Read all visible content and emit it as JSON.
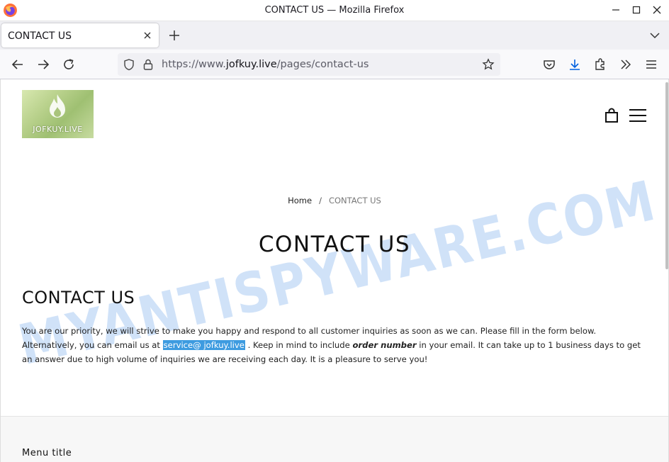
{
  "window": {
    "title": "CONTACT US — Mozilla Firefox"
  },
  "tabs": [
    {
      "label": "CONTACT US"
    }
  ],
  "urlbar": {
    "prefix": "https://www.",
    "domain": "jofkuy.live",
    "path": "/pages/contact-us"
  },
  "site": {
    "logo_text": "JOFKUY.LIVE",
    "watermark": "MYANTISPYWARE.COM"
  },
  "breadcrumb": {
    "home": "Home",
    "separator": "/",
    "current": "CONTACT US"
  },
  "page": {
    "heading": "CONTACT US",
    "section_heading": "CONTACT US",
    "paragraph_part1": "You are our priority, we will strive to make you happy and respond to all customer inquiries as soon as we can. Please fill in the form below. Alternatively, you can email us at ",
    "email": "service@ jofkuy.live",
    "paragraph_part2": " . Keep in mind to include ",
    "paragraph_emphasis": "order number",
    "paragraph_part3": " in your email. It can take up to 1  business days to get an answer due to high volume of inquiries we are receiving each day. It is a pleasure to serve you!"
  },
  "footer": {
    "menu_title": "Menu title"
  },
  "colors": {
    "email_highlight": "#3d9be0",
    "watermark": "#2f7fe0"
  }
}
